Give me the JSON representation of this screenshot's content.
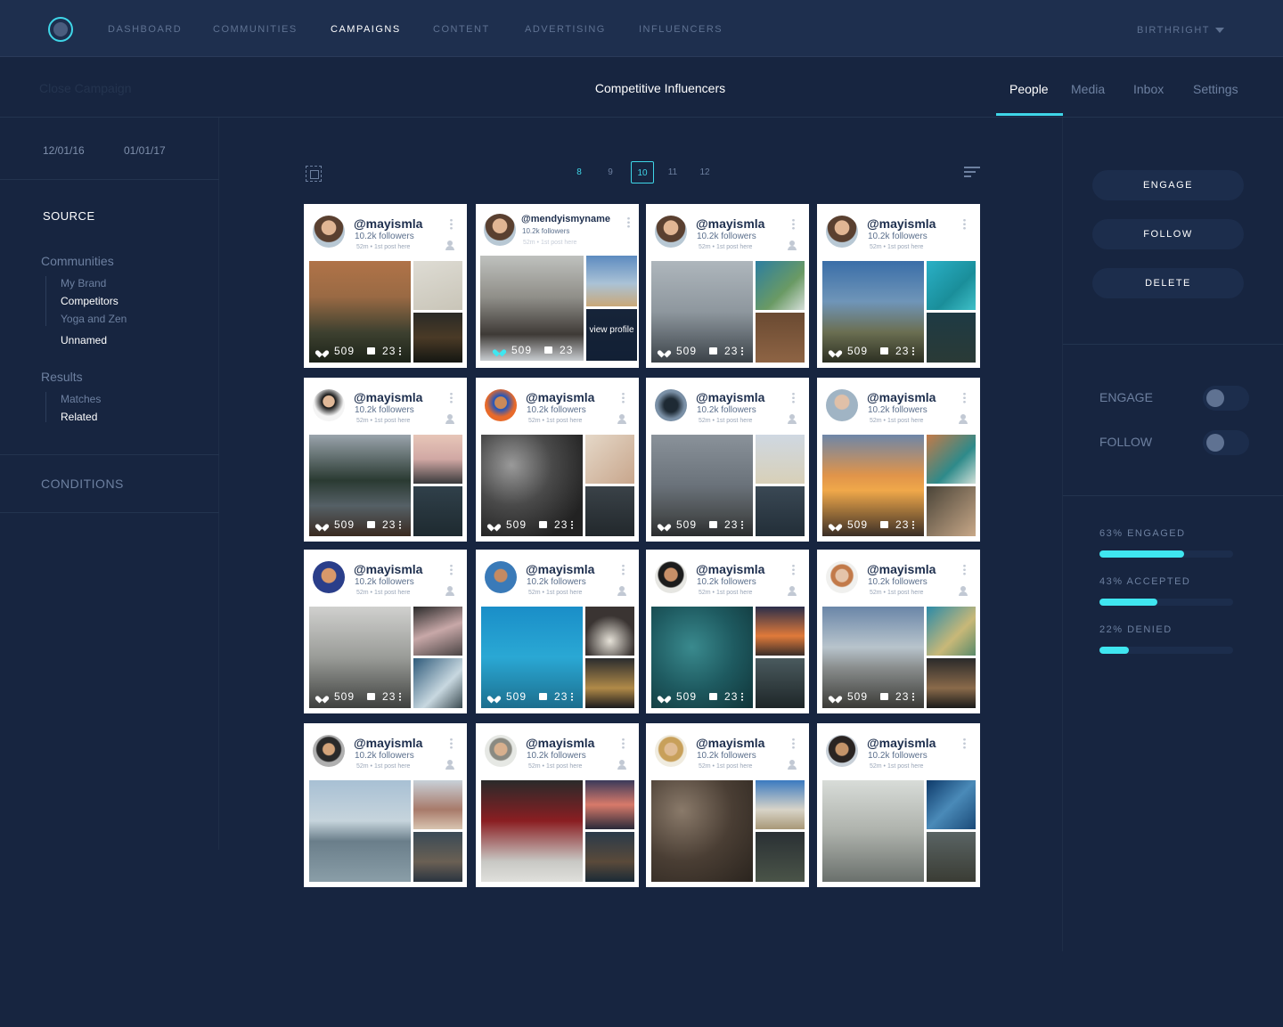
{
  "nav": {
    "items": [
      "DASHBOARD",
      "COMMUNITIES",
      "CAMPAIGNS",
      "CONTENT",
      "ADVERTISING",
      "INFLUENCERS"
    ],
    "active": "CAMPAIGNS",
    "account": "BIRTHRIGHT"
  },
  "subheader": {
    "close_label": "Close Campaign",
    "title": "Competitive Influencers",
    "tabs": [
      "People",
      "Media",
      "Inbox",
      "Settings"
    ],
    "active_tab": "People"
  },
  "sidebar": {
    "date_start": "12/01/16",
    "date_end": "01/01/17",
    "source_label": "SOURCE",
    "communities": {
      "label": "Communities",
      "items": [
        "My Brand",
        "Competitors",
        "Yoga and Zen",
        "Unnamed"
      ],
      "selected": [
        "Competitors",
        "Unnamed"
      ]
    },
    "results": {
      "label": "Results",
      "items": [
        "Matches",
        "Related"
      ],
      "selected": [
        "Related"
      ]
    },
    "conditions_label": "CONDITIONS"
  },
  "pagination": {
    "pages": [
      "8",
      "9",
      "10",
      "11",
      "12"
    ],
    "current": "10"
  },
  "actions": {
    "engage": "ENGAGE",
    "follow": "FOLLOW",
    "delete": "DELETE"
  },
  "toggles": {
    "engage_label": "ENGAGE",
    "follow_label": "FOLLOW"
  },
  "progress": [
    {
      "label": "63% ENGAGED",
      "value": 0.63
    },
    {
      "label": "43% ACCEPTED",
      "value": 0.43
    },
    {
      "label": "22% DENIED",
      "value": 0.22
    }
  ],
  "cards": [
    {
      "username": "@mayismla",
      "followers": "10.2k followers",
      "meta": "52m • 1st post here",
      "likes": "509",
      "comments": "23"
    },
    {
      "username": "@mendyismyname",
      "followers": "10.2k followers",
      "meta": "52m • 1st post here",
      "likes": "509",
      "comments": "23",
      "overlay": "view profile"
    },
    {
      "username": "@mayismla",
      "followers": "10.2k followers",
      "meta": "52m • 1st post here",
      "likes": "509",
      "comments": "23"
    },
    {
      "username": "@mayismla",
      "followers": "10.2k followers",
      "meta": "52m • 1st post here",
      "likes": "509",
      "comments": "23"
    },
    {
      "username": "@mayismla",
      "followers": "10.2k followers",
      "meta": "52m • 1st post here",
      "likes": "509",
      "comments": "23"
    },
    {
      "username": "@mayismla",
      "followers": "10.2k followers",
      "meta": "52m • 1st post here",
      "likes": "509",
      "comments": "23"
    },
    {
      "username": "@mayismla",
      "followers": "10.2k followers",
      "meta": "52m • 1st post here",
      "likes": "509",
      "comments": "23"
    },
    {
      "username": "@mayismla",
      "followers": "10.2k followers",
      "meta": "52m • 1st post here",
      "likes": "509",
      "comments": "23"
    },
    {
      "username": "@mayismla",
      "followers": "10.2k followers",
      "meta": "52m • 1st post here",
      "likes": "509",
      "comments": "23"
    },
    {
      "username": "@mayismla",
      "followers": "10.2k followers",
      "meta": "52m • 1st post here",
      "likes": "509",
      "comments": "23"
    },
    {
      "username": "@mayismla",
      "followers": "10.2k followers",
      "meta": "52m • 1st post here",
      "likes": "509",
      "comments": "23"
    },
    {
      "username": "@mayismla",
      "followers": "10.2k followers",
      "meta": "52m • 1st post here",
      "likes": "509",
      "comments": "23"
    },
    {
      "username": "@mayismla",
      "followers": "10.2k followers",
      "meta": "52m • 1st post here"
    },
    {
      "username": "@mayismla",
      "followers": "10.2k followers",
      "meta": "52m • 1st post here"
    },
    {
      "username": "@mayismla",
      "followers": "10.2k followers",
      "meta": "52m • 1st post here"
    },
    {
      "username": "@mayismla",
      "followers": "10.2k followers",
      "meta": "52m • 1st post here"
    }
  ]
}
